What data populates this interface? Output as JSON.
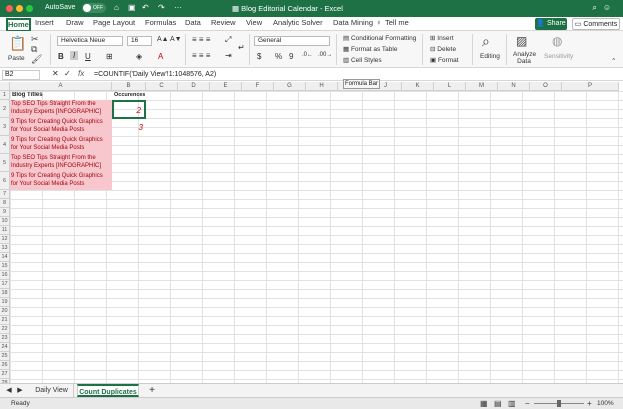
{
  "titlebar": {
    "autosave": "AutoSave",
    "toggle": "OFF",
    "title": "Blog Editorial Calendar - Excel"
  },
  "tabs": [
    "Home",
    "Insert",
    "Draw",
    "Page Layout",
    "Formulas",
    "Data",
    "Review",
    "View",
    "Analytic Solver",
    "Data Mining"
  ],
  "tellme": "Tell me",
  "share": "Share",
  "comments": "Comments",
  "ribbon": {
    "paste": "Paste",
    "font": "Helvetica Neue",
    "size": "16",
    "numformat": "General",
    "cond": "Conditional Formatting",
    "table": "Format as Table",
    "styles": "Cell Styles",
    "insert": "Insert",
    "delete": "Delete",
    "format": "Format",
    "editing": "Editing",
    "analyze": "Analyze Data",
    "sensitivity": "Sensitivity"
  },
  "formula": {
    "namebox": "B2",
    "content": "=COUNTIF('Daily View'!1:1048576, A2)",
    "tooltip": "Formula Bar"
  },
  "columns": [
    "A",
    "B",
    "C",
    "D",
    "E",
    "F",
    "G",
    "H",
    "I",
    "J",
    "K",
    "L",
    "M",
    "N",
    "O",
    "P"
  ],
  "rows": [
    "1",
    "2",
    "3",
    "4",
    "5",
    "6",
    "7",
    "8",
    "9",
    "10",
    "11",
    "12",
    "13",
    "14",
    "15",
    "16",
    "17",
    "18",
    "19",
    "20",
    "21",
    "22",
    "23",
    "24",
    "25",
    "26",
    "27",
    "28",
    "29",
    "30",
    "31"
  ],
  "cells": {
    "a1": "Blog Titles",
    "b1": "Occurences",
    "a2": "Top SEO Tips Straight From the Industry Experts [INFOGRAPHIC]",
    "a3": "9 Tips for Creating Quick Graphics for Your Social Media Posts",
    "a4": "9 Tips for Creating Quick Graphics for Your Social Media Posts",
    "a5": "Top SEO Tips Straight From the Industry Experts [INFOGRAPHIC]",
    "a6": "9 Tips for Creating Quick Graphics for Your Social Media Posts",
    "b2": "2",
    "b3": "3"
  },
  "sheets": [
    "Daily View",
    "Count Duplicates"
  ],
  "status": {
    "ready": "Ready",
    "zoom": "100%"
  }
}
